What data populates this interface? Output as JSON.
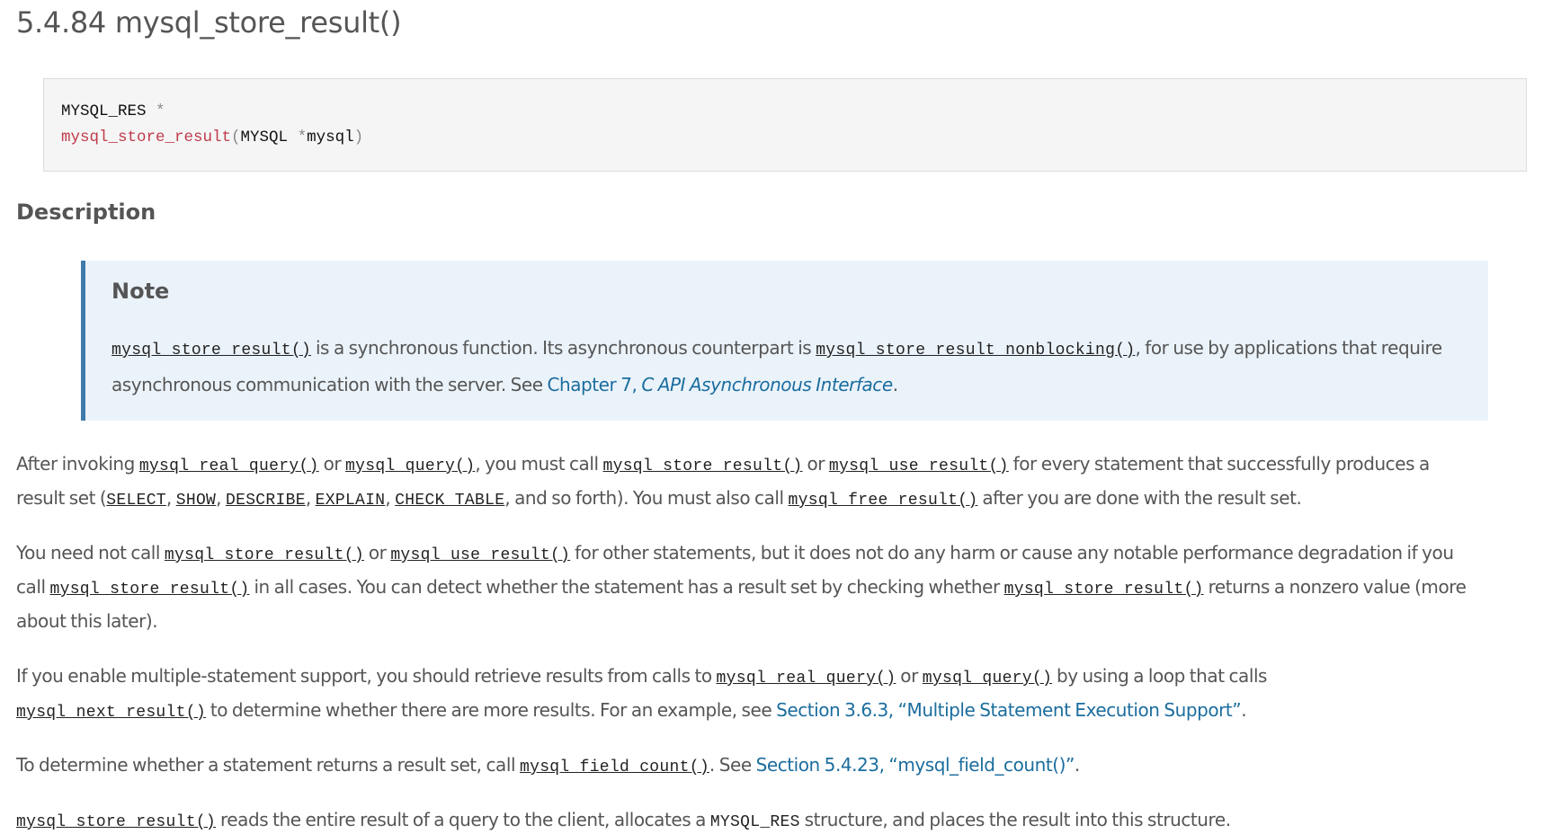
{
  "heading": "5.4.84 mysql_store_result()",
  "synopsis": {
    "return_type": "MYSQL_RES",
    "star": "*",
    "function_name": "mysql_store_result",
    "open_paren": "(",
    "param_type": "MYSQL",
    "param_star": "*",
    "param_name": "mysql",
    "close_paren": ")"
  },
  "description_heading": "Description",
  "note": {
    "title": "Note",
    "code1": "mysql_store_result()",
    "text1": " is a synchronous function. Its asynchronous counterpart is ",
    "code2": "mysql_store_result_nonblocking()",
    "text2": ", for use by applications that require asynchronous communication with the server. See ",
    "link_prefix": "Chapter 7, ",
    "link_italic": "C API Asynchronous Interface",
    "text3": "."
  },
  "paragraphs": {
    "p1": {
      "t0": "After invoking ",
      "c0": "mysql_real_query()",
      "t1": " or ",
      "c1": "mysql_query()",
      "t2": ", you must call ",
      "c2": "mysql_store_result()",
      "t3": " or ",
      "c3": "mysql_use_result()",
      "t4": " for every statement that successfully produces a",
      "t5": "result set (",
      "c4": "SELECT",
      "t6": ", ",
      "c5": "SHOW",
      "t7": ", ",
      "c6": "DESCRIBE",
      "t8": ", ",
      "c7": "EXPLAIN",
      "t9": ", ",
      "c8": "CHECK TABLE",
      "t10": ", and so forth). You must also call ",
      "c9": "mysql_free_result()",
      "t11": " after you are done with the result set."
    },
    "p2": {
      "t0": "You need not call ",
      "c0": "mysql_store_result()",
      "t1": " or ",
      "c1": "mysql_use_result()",
      "t2": " for other statements, but it does not do any harm or cause any notable performance degradation if you",
      "t3": "call ",
      "c2": "mysql_store_result()",
      "t4": " in all cases. You can detect whether the statement has a result set by checking whether ",
      "c3": "mysql_store_result()",
      "t5": " returns a nonzero value (more",
      "t6": "about this later)."
    },
    "p3": {
      "t0": "If you enable multiple-statement support, you should retrieve results from calls to ",
      "c0": "mysql_real_query()",
      "t1": " or ",
      "c1": "mysql_query()",
      "t2": " by using a loop that calls",
      "c2": "mysql_next_result()",
      "t3": " to determine whether there are more results. For an example, see ",
      "link": "Section 3.6.3, “Multiple Statement Execution Support”",
      "t4": "."
    },
    "p4": {
      "t0": "To determine whether a statement returns a result set, call ",
      "c0": "mysql_field_count()",
      "t1": ". See ",
      "link": "Section 5.4.23, “mysql_field_count()”",
      "t2": "."
    },
    "p5": {
      "c0": "mysql_store_result()",
      "t0": " reads the entire result of a query to the client, allocates a ",
      "lit": "MYSQL_RES",
      "t1": " structure, and places the result into this structure."
    }
  }
}
